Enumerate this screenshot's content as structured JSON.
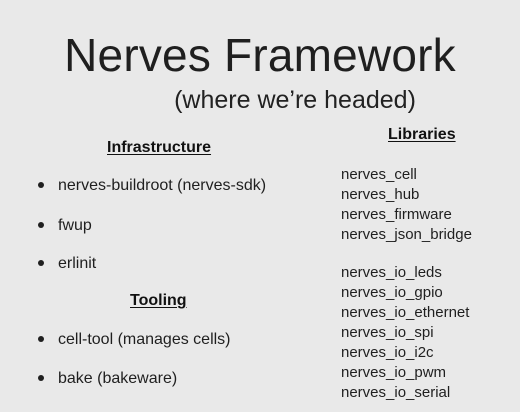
{
  "slide": {
    "title": "Nerves Framework",
    "subtitle": "(where we’re headed)",
    "infrastructure": {
      "heading": "Infrastructure",
      "items": [
        "nerves-buildroot (nerves-sdk)",
        "fwup",
        "erlinit"
      ]
    },
    "tooling": {
      "heading": "Tooling",
      "items": [
        "cell-tool (manages cells)",
        "bake (bakeware)"
      ]
    },
    "libraries": {
      "heading": "Libraries",
      "group1": [
        "nerves_cell",
        "nerves_hub",
        "nerves_firmware",
        "nerves_json_bridge"
      ],
      "group2": [
        "nerves_io_leds",
        "nerves_io_gpio",
        "nerves_io_ethernet",
        "nerves_io_spi",
        "nerves_io_i2c",
        "nerves_io_pwm",
        "nerves_io_serial"
      ]
    }
  }
}
